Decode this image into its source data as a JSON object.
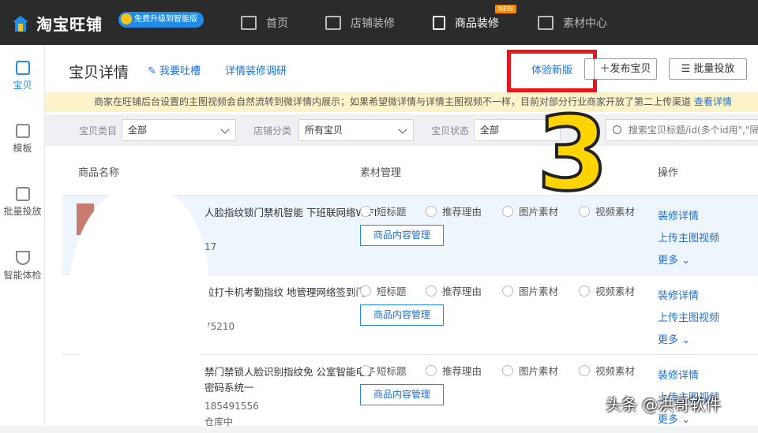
{
  "app": {
    "logo_text": "淘宝旺铺",
    "upgrade_badge": "免费升级到智能版"
  },
  "topnav": [
    {
      "label": "首页"
    },
    {
      "label": "店铺装修"
    },
    {
      "label": "商品装修"
    },
    {
      "label": "素材中心"
    }
  ],
  "new_tag": "NEW",
  "leftnav": [
    {
      "label": "宝贝"
    },
    {
      "label": "模板"
    },
    {
      "label": "批量投放"
    },
    {
      "label": "智能体检"
    }
  ],
  "header": {
    "title": "宝贝详情",
    "link_feedback": "我要吐槽",
    "link_survey": "详情装修调研",
    "btn_new_version": "体验新版",
    "btn_publish": "发布宝贝",
    "btn_batch": "批量投放"
  },
  "notice": {
    "text": "商家在旺铺后台设置的主图视频会自然流转到微详情内展示；如果希望微详情与详情主图视频不一样，目前对部分行业商家开放了第二上传渠道",
    "link": "查看详情"
  },
  "filters": {
    "category_label": "宝贝类目",
    "category_value": "全部",
    "shop_label": "店铺分类",
    "shop_value": "所有宝贝",
    "status_label": "宝贝状态",
    "status_value": "全部",
    "search_placeholder": "搜索宝贝标题/id(多个id用\",\"隔开)"
  },
  "table": {
    "headers": {
      "name": "商品名称",
      "material": "素材管理",
      "ops": "操作"
    },
    "radio_labels": [
      "短标题",
      "推荐理由",
      "图片素材",
      "视频素材"
    ],
    "manage_label": "商品内容管理",
    "op_detail": "装修详情",
    "op_video": "上传主图视频",
    "op_more": "更多",
    "rows": [
      {
        "name": "人脸指纹锁门禁机智能 下班联网络WIFI",
        "id": "17"
      },
      {
        "name": "拉打卡机考勤指纹 地管理网络签到门",
        "id": "75210"
      },
      {
        "name": "禁门禁锁人脸识别指纹免 公室智能电子密码系统一",
        "id": "185491556",
        "extra": "仓库中"
      }
    ]
  },
  "overlay": {
    "number": "3",
    "watermark": "头条 @洪哥软件"
  },
  "colors": {
    "accent": "#1e8ce8",
    "highlight_box": "#e8151b",
    "notice_bg": "#fdf3c9"
  }
}
